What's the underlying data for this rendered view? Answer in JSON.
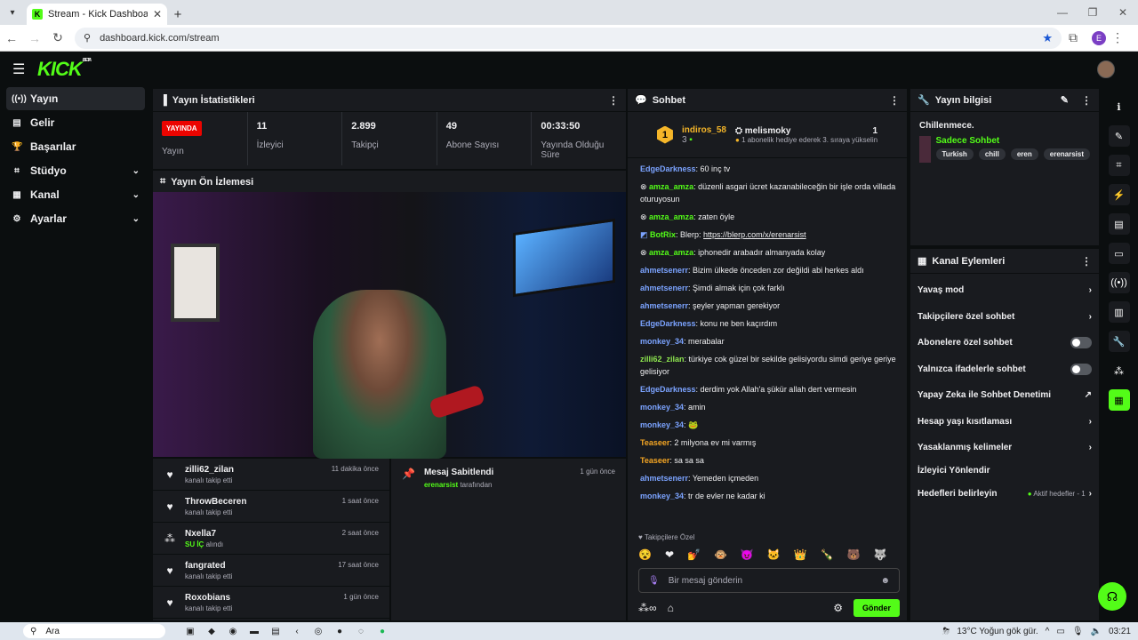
{
  "browser": {
    "tab_title": "Stream - Kick Dashboard",
    "tab_favicon": "K",
    "url": "dashboard.kick.com/stream",
    "profile_initial": "E"
  },
  "brand": {
    "logo": "KICK",
    "beta": "BETA",
    "accent": "#53fc18"
  },
  "sidebar": {
    "items": [
      {
        "label": "Yayın",
        "icon": "broadcast-icon",
        "active": true
      },
      {
        "label": "Gelir",
        "icon": "wallet-icon"
      },
      {
        "label": "Başarılar",
        "icon": "trophy-icon"
      },
      {
        "label": "Stüdyo",
        "icon": "studio-icon",
        "expand": true
      },
      {
        "label": "Kanal",
        "icon": "channel-icon",
        "expand": true
      },
      {
        "label": "Ayarlar",
        "icon": "gear-icon",
        "expand": true
      }
    ]
  },
  "stats": {
    "title": "Yayın İstatistikleri",
    "live_badge": "YAYINDA",
    "live_label": "Yayın",
    "viewers_value": "11",
    "viewers_label": "İzleyici",
    "followers_value": "2.899",
    "followers_label": "Takipçi",
    "subs_value": "49",
    "subs_label": "Abone Sayısı",
    "uptime_value": "00:33:50",
    "uptime_label": "Yayında Olduğu Süre"
  },
  "preview": {
    "title": "Yayın Ön İzlemesi"
  },
  "activity": [
    {
      "name": "zilli62_zilan",
      "desc": "kanalı takip etti",
      "time": "11 dakika önce",
      "icon": "heart-icon"
    },
    {
      "name": "ThrowBeceren",
      "desc": "kanalı takip etti",
      "time": "1 saat önce",
      "icon": "heart-icon"
    },
    {
      "name": "Nxella7",
      "desc_highlight": "SU İÇ",
      "desc": "alındı",
      "time": "2 saat önce",
      "icon": "points-icon"
    },
    {
      "name": "fangrated",
      "desc": "kanalı takip etti",
      "time": "17 saat önce",
      "icon": "heart-icon"
    },
    {
      "name": "Roxobians",
      "desc": "kanalı takip etti",
      "time": "1 gün önce",
      "icon": "heart-icon"
    }
  ],
  "pinned": {
    "title": "Mesaj Sabitlendi",
    "by_user": "erenarsist",
    "by_suffix": "tarafından",
    "time": "1 gün önce"
  },
  "chat": {
    "title": "Sohbet",
    "top_user": "indiros_58",
    "top_rank": "1",
    "top_count": "3",
    "gifter": "melismoky",
    "gift_count": "1",
    "gift_text": "1 abonelik hediye ederek 3. sıraya yükselin",
    "messages": [
      {
        "user": "EdgeDarkness",
        "color": "c-blue",
        "text": "60 inç tv"
      },
      {
        "user": "amza_amza",
        "color": "c-green",
        "text": "düzenli asgari ücret kazanabileceğin bir işle orda villada oturuyosun",
        "badge": true
      },
      {
        "user": "amza_amza",
        "color": "c-green",
        "text": "zaten öyle",
        "badge": true
      },
      {
        "user": "BotRix",
        "color": "c-green",
        "text": "Blerp: ",
        "link": "https://blerp.com/x/erenarsist",
        "bot": true
      },
      {
        "user": "amza_amza",
        "color": "c-green",
        "text": "iphonedir arabadır almanyada kolay",
        "badge": true
      },
      {
        "user": "ahmetsenerr",
        "color": "c-blue",
        "text": "Bizim ülkede önceden zor değildi abi herkes aldı"
      },
      {
        "user": "ahmetsenerr",
        "color": "c-blue",
        "text": "Şimdi almak için çok farklı"
      },
      {
        "user": "ahmetsenerr",
        "color": "c-blue",
        "text": "şeyler yapman gerekiyor"
      },
      {
        "user": "EdgeDarkness",
        "color": "c-blue",
        "text": "konu ne ben kaçırdım"
      },
      {
        "user": "monkey_34",
        "color": "c-blue",
        "text": "merabalar"
      },
      {
        "user": "zilli62_zilan",
        "color": "c-lgreen",
        "text": "türkiye cok güzel bir sekilde gelisiyordu simdi geriye geriye gelisiyor"
      },
      {
        "user": "EdgeDarkness",
        "color": "c-blue",
        "text": "derdim yok Allah'a şükür allah dert vermesin"
      },
      {
        "user": "monkey_34",
        "color": "c-blue",
        "text": "amin"
      },
      {
        "user": "monkey_34",
        "color": "c-blue",
        "text": "🐸"
      },
      {
        "user": "Teaseer",
        "color": "c-orange",
        "text": "2 milyona ev mi varmış"
      },
      {
        "user": "Teaseer",
        "color": "c-orange",
        "text": "sa sa sa"
      },
      {
        "user": "ahmetsenerr",
        "color": "c-blue",
        "text": "Yemeden içmeden"
      },
      {
        "user": "monkey_34",
        "color": "c-blue",
        "text": "tr de evler ne kadar ki"
      }
    ],
    "mode_label": "Takipçilere Özel",
    "emotes": [
      "😵",
      "❤",
      "💅",
      "🐵",
      "😈",
      "🐱",
      "👑",
      "🍾",
      "🐻",
      "🐺"
    ],
    "placeholder": "Bir mesaj gönderin",
    "send_label": "Gönder"
  },
  "info": {
    "title": "Yayın bilgisi",
    "stream_title": "Chillenmece.",
    "category": "Sadece Sohbet",
    "tags": [
      "Turkish",
      "chill",
      "eren",
      "erenarsist"
    ]
  },
  "actions": {
    "title": "Kanal Eylemleri",
    "slow": "Yavaş mod",
    "followers": "Takipçilere özel sohbet",
    "subs": "Abonelere özel sohbet",
    "emotes": "Yalnızca ifadelerle sohbet",
    "ai": "Yapay Zeka ile Sohbet Denetimi",
    "age": "Hesap yaşı kısıtlaması",
    "banned": "Yasaklanmış kelimeler",
    "redirect": "İzleyici Yönlendir",
    "goals": "Hedefleri belirleyin",
    "goals_status": "Aktif hedefler - 1"
  },
  "taskbar": {
    "search": "Ara",
    "weather": "13°C  Yoğun gök gür.",
    "time": "03:21"
  }
}
